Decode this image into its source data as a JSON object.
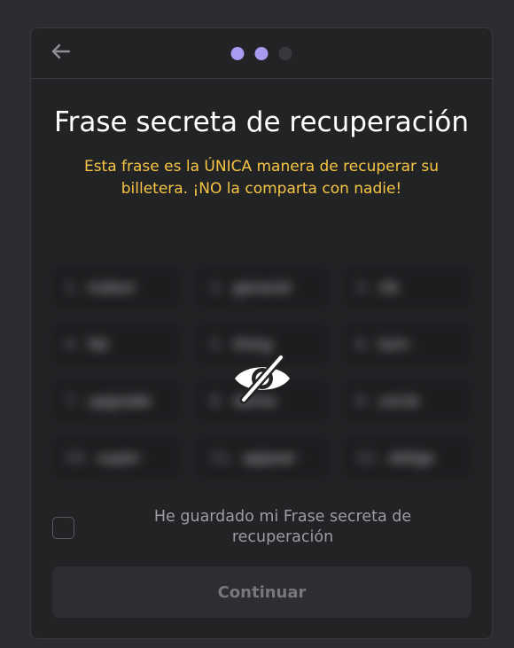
{
  "header": {
    "back_icon": "arrow-left-icon",
    "steps": [
      {
        "state": "active",
        "color": "#a99cf0"
      },
      {
        "state": "active",
        "color": "#a99cf0"
      },
      {
        "state": "inactive",
        "color": "#38393c"
      }
    ]
  },
  "title": "Frase secreta de recuperación",
  "warning": "Esta frase es la ÚNICA manera de recuperar su billetera. ¡NO la comparta con nadie!",
  "phrase": {
    "hidden": true,
    "reveal_icon": "eye-slash-icon",
    "words": [
      {
        "num": "1.",
        "word": "indoor"
      },
      {
        "num": "2.",
        "word": "general"
      },
      {
        "num": "3.",
        "word": "rib"
      },
      {
        "num": "4.",
        "word": "fat"
      },
      {
        "num": "5.",
        "word": "thing"
      },
      {
        "num": "6.",
        "word": "torn"
      },
      {
        "num": "7.",
        "word": "upgrade"
      },
      {
        "num": "8.",
        "word": "dome"
      },
      {
        "num": "9.",
        "word": "uncle"
      },
      {
        "num": "10.",
        "word": "super"
      },
      {
        "num": "11.",
        "word": "appear"
      },
      {
        "num": "12.",
        "word": "oblige"
      }
    ]
  },
  "confirm": {
    "checked": false,
    "label": "He guardado mi Frase secreta de recuperación"
  },
  "continue_button": {
    "label": "Continuar",
    "disabled": true
  },
  "colors": {
    "accent": "#a99cf0",
    "warning": "#f7c543",
    "panel_bg": "#222325",
    "page_bg": "#2b2c30"
  }
}
